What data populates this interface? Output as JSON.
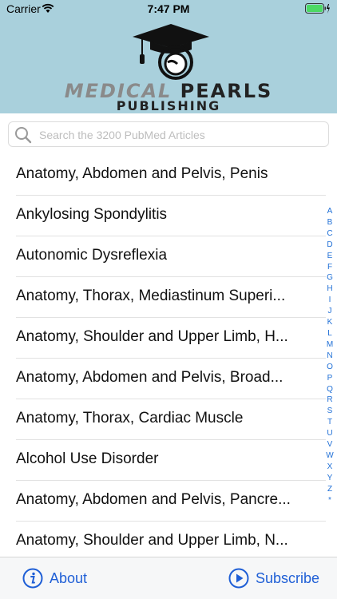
{
  "status": {
    "carrier": "Carrier",
    "time": "7:47 PM"
  },
  "header": {
    "logo_word1": "MEDICAL",
    "logo_word2": "PEARLS",
    "logo_word3": "PUBLISHING"
  },
  "search": {
    "placeholder": "Search the 3200 PubMed Articles"
  },
  "articles": [
    "Anatomy, Abdomen and Pelvis, Penis",
    "Ankylosing Spondylitis",
    "Autonomic Dysreflexia",
    "Anatomy, Thorax, Mediastinum Superi...",
    "Anatomy, Shoulder and Upper Limb, H...",
    "Anatomy, Abdomen and Pelvis, Broad...",
    "Anatomy, Thorax, Cardiac Muscle",
    "Alcohol Use Disorder",
    "Anatomy, Abdomen and Pelvis, Pancre...",
    "Anatomy, Shoulder and Upper Limb, N..."
  ],
  "index_letters": [
    "A",
    "B",
    "C",
    "D",
    "E",
    "F",
    "G",
    "H",
    "I",
    "J",
    "K",
    "L",
    "M",
    "N",
    "O",
    "P",
    "Q",
    "R",
    "S",
    "T",
    "U",
    "V",
    "W",
    "X",
    "Y",
    "Z",
    "*"
  ],
  "bottom": {
    "about": "About",
    "subscribe": "Subscribe"
  },
  "colors": {
    "header_bg": "#a9d0dc",
    "accent": "#1f5fd6",
    "battery": "#4cd964"
  },
  "icons": {
    "about": "info-circle-icon",
    "subscribe": "play-circle-icon",
    "search": "magnifier-icon"
  }
}
